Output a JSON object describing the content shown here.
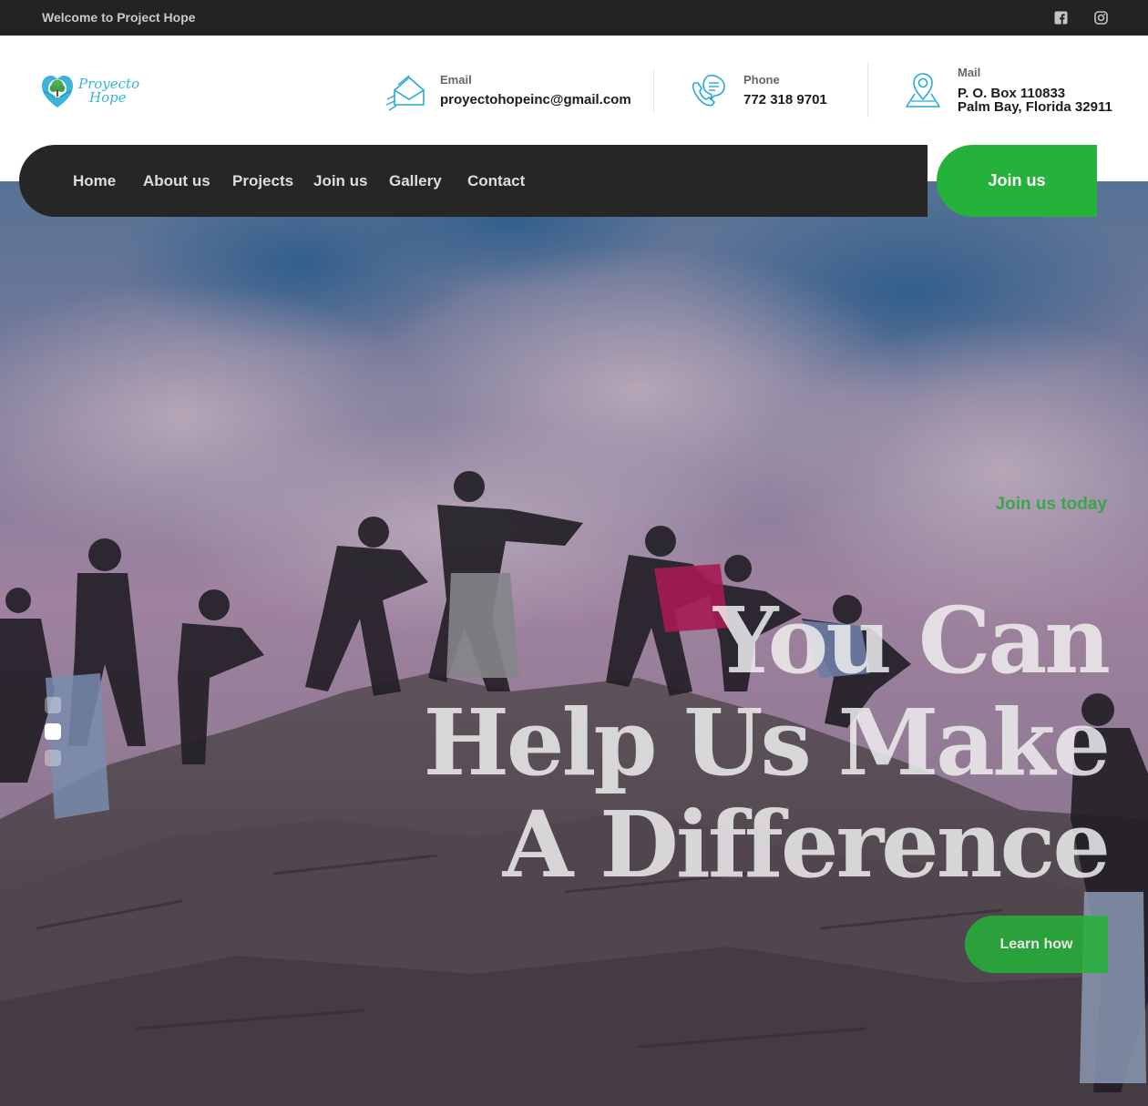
{
  "topbar": {
    "welcome": "Welcome to Project Hope",
    "social": [
      {
        "icon": "facebook-icon"
      },
      {
        "icon": "instagram-icon"
      }
    ]
  },
  "header": {
    "logo": {
      "line1": "Proyecto",
      "line2": "Hope",
      "icon": "heart-tree-logo"
    },
    "email": {
      "label": "Email",
      "value": "proyectohopeinc@gmail.com",
      "icon": "envelope-icon"
    },
    "phone": {
      "label": "Phone",
      "value": "772 318 9701",
      "icon": "phone-chat-icon"
    },
    "mail": {
      "label": "Mail",
      "line1": "P. O. Box 110833",
      "line2": "Palm Bay, Florida 32911",
      "icon": "map-pin-icon"
    }
  },
  "nav": {
    "items": [
      "Home",
      "About us",
      "Projects",
      "Join us",
      "Gallery",
      "Contact"
    ],
    "cta": "Join us"
  },
  "hero": {
    "subtitle": "Join us today",
    "title_line1": "You Can",
    "title_line2": "Help Us Make",
    "title_line3": "A Difference",
    "cta": "Learn how"
  },
  "colors": {
    "accent_green": "#24b23a",
    "dark": "#232323",
    "icon_blue": "#29a8d8"
  }
}
